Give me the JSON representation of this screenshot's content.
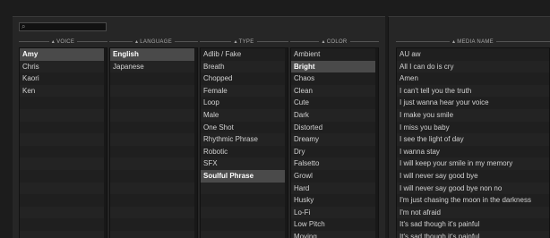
{
  "search": {
    "placeholder": ""
  },
  "columns": {
    "voice": {
      "header": "VOICE",
      "items": [
        "Amy",
        "Chris",
        "Kaori",
        "Ken"
      ],
      "selected": 0
    },
    "language": {
      "header": "LANGUAGE",
      "items": [
        "English",
        "Japanese"
      ],
      "selected": 0
    },
    "type": {
      "header": "TYPE",
      "items": [
        "Adlib / Fake",
        "Breath",
        "Chopped",
        "Female",
        "Loop",
        "Male",
        "One Shot",
        "Rhythmic Phrase",
        "Robotic",
        "SFX",
        "Soulful Phrase"
      ],
      "selected": 10
    },
    "color": {
      "header": "COLOR",
      "items": [
        "Ambient",
        "Bright",
        "Chaos",
        "Clean",
        "Cute",
        "Dark",
        "Distorted",
        "Dreamy",
        "Dry",
        "Falsetto",
        "Growl",
        "Hard",
        "Husky",
        "Lo-Fi",
        "Low Pitch",
        "Moving"
      ],
      "selected": 1
    },
    "media": {
      "header": "MEDIA NAME",
      "items": [
        "AU aw",
        "All I can do is cry",
        "Amen",
        "I can't tell you the truth",
        "I just wanna hear your voice",
        "I make you smile",
        "I miss you baby",
        "I see the light of day",
        "I wanna stay",
        "I will keep your smile in my memory",
        "I will never say good bye",
        "I will never say good bye non no",
        "I'm just chasing the moon in the darkness",
        "I'm not afraid",
        "It's sad though it's painful",
        "It's sad though it's painful"
      ],
      "selected": -1
    }
  },
  "colors": {
    "background": "#1c1c1c",
    "panel": "#262626",
    "selected_row": "#4a4a4a"
  }
}
